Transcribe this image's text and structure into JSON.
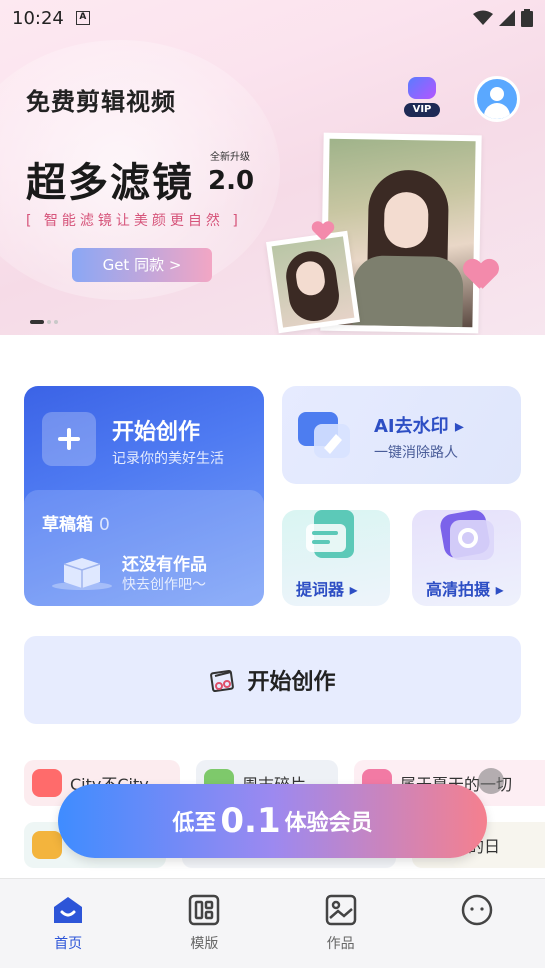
{
  "status_bar": {
    "time": "10:24",
    "indicator": "A"
  },
  "banner": {
    "app_title": "免费剪辑视频",
    "vip_label": "VIP",
    "upgrade_tag": "全新升级",
    "headline": "超多滤镜",
    "version": "2.0",
    "subhead": "[ 智能滤镜让美颜更自然 ]",
    "cta": "Get 同款 >",
    "carousel_pages": 3,
    "carousel_active": 0
  },
  "features": {
    "create": {
      "title": "开始创作",
      "subtitle": "记录你的美好生活"
    },
    "drafts": {
      "title": "草稿箱",
      "count": "0",
      "empty_title": "还没有作品",
      "empty_subtitle": "快去创作吧～"
    },
    "ai_watermark": {
      "title": "AI去水印 ▸",
      "subtitle": "一键消除路人"
    },
    "prompter": {
      "label": "提词器 ▸"
    },
    "hd_shoot": {
      "label": "高清拍摄 ▸"
    }
  },
  "start_bar": {
    "label": "开始创作"
  },
  "templates": {
    "row1": [
      "City不City",
      "周末碎片",
      "属于夏天的一切"
    ],
    "row2": [
      "",
      "",
      "日摄我的日"
    ]
  },
  "promo": {
    "prefix": "低至",
    "number": "0.1",
    "suffix": "体验会员"
  },
  "bottom_nav": [
    {
      "label": "首页",
      "icon": "home-icon",
      "active": true
    },
    {
      "label": "模版",
      "icon": "template-icon",
      "active": false
    },
    {
      "label": "作品",
      "icon": "works-icon",
      "active": false
    },
    {
      "label": "",
      "icon": "profile-icon",
      "active": false
    }
  ],
  "colors": {
    "accent": "#2d55d8",
    "brand_blue": "#3b63e6",
    "promo_start": "#3f8cff",
    "promo_end": "#f5808e"
  }
}
